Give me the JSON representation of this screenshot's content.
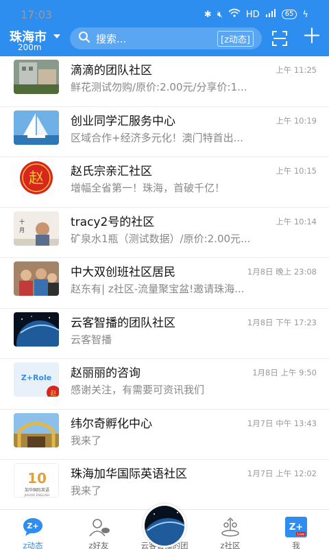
{
  "status_bar": {
    "time": "17:03",
    "network": "HD",
    "battery": "65"
  },
  "header": {
    "city": "珠海市",
    "distance": "200m",
    "search_placeholder": "搜索...",
    "search_tag": "[z动态]"
  },
  "list": [
    {
      "title": "滴滴的团队社区",
      "subtitle": "鲜花测试勿购/原价:2.00元/分享价:1...",
      "time": "上午 11:25",
      "avatar": "building-photo"
    },
    {
      "title": "创业同学汇服务中心",
      "subtitle": "区域合作+经济多元化！澳门特首出...",
      "time": "上午 10:19",
      "avatar": "sailboat-photo"
    },
    {
      "title": "赵氏宗亲汇社区",
      "subtitle": "增幅全省第一！珠海，首破千亿！",
      "time": "上午 10:15",
      "avatar": "zhao-seal"
    },
    {
      "title": "tracy2号的社区",
      "subtitle": "矿泉水1瓶（测试数据）/原价:2.00元...",
      "time": "上午 10:14",
      "avatar": "child-photo"
    },
    {
      "title": "中大双创班社区居民",
      "subtitle": "赵东有| z社区-流量聚宝盆!邀请珠海...",
      "time": "1月8日 晚上 23:08",
      "avatar": "group-photo"
    },
    {
      "title": "云客智播的团队社区",
      "subtitle": "云客智播",
      "time": "1月8日 下午 17:23",
      "avatar": "earth-photo"
    },
    {
      "title": "赵丽丽的咨询",
      "subtitle": "感谢关注，有需要可资讯我们",
      "time": "1月8日 上午 9:50",
      "avatar": "z-role-logo"
    },
    {
      "title": "纬尔奇孵化中心",
      "subtitle": "我来了",
      "time": "1月7日 中午 13:43",
      "avatar": "gate-photo"
    },
    {
      "title": "珠海加华国际英语社区",
      "subtitle": "我来了",
      "time": "1月7日 上午 12:02",
      "avatar": "ten-anniversary-logo"
    }
  ],
  "avatar_texts": {
    "zrole": "Z+Role",
    "zhao": "赵",
    "ten": "10",
    "ten_caption": "加华国际英语",
    "ten_caption_en": "JIAHUA ENGLISH"
  },
  "nav": [
    {
      "label": "z动态",
      "active": true
    },
    {
      "label": "z好友",
      "active": false
    },
    {
      "label": "云客智播的团",
      "active": false
    },
    {
      "label": "z社区",
      "active": false
    },
    {
      "label": "我",
      "active": false
    }
  ],
  "nav_icon_texts": {
    "zplus": "Z+",
    "live": "Live"
  },
  "colors": {
    "primary": "#2e8ef0",
    "text_primary": "#111111",
    "text_secondary": "#888888",
    "seal_red": "#d8261e"
  }
}
